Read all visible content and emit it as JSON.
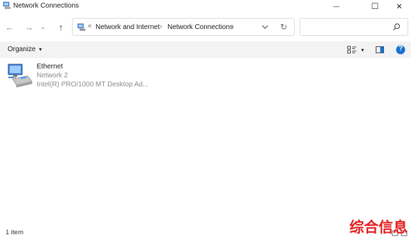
{
  "window": {
    "title": "Network Connections",
    "minimize_glyph": "—",
    "maximize_glyph": "☐",
    "close_glyph": "✕"
  },
  "nav": {
    "back_glyph": "←",
    "forward_glyph": "→",
    "history_glyph": "⌄",
    "up_glyph": "↑",
    "address_overflow": "«",
    "breadcrumbs": [
      "Network and Internet",
      "Network Connections"
    ],
    "crumb_separator": "›",
    "refresh_glyph": "↻",
    "search_placeholder": ""
  },
  "command_bar": {
    "organize_label": "Organize",
    "organize_caret": "▾",
    "view_caret": "▾",
    "help_glyph": "?"
  },
  "items": [
    {
      "name": "Ethernet",
      "network": "Network 2",
      "adapter": "Intel(R) PRO/1000 MT Desktop Ad..."
    }
  ],
  "status": {
    "item_count": "1 item"
  },
  "watermark": "综合信息",
  "colors": {
    "accent_blue": "#1a6fd1",
    "command_bar_bg": "#f3f3f3",
    "watermark_red": "#e21e1e"
  }
}
